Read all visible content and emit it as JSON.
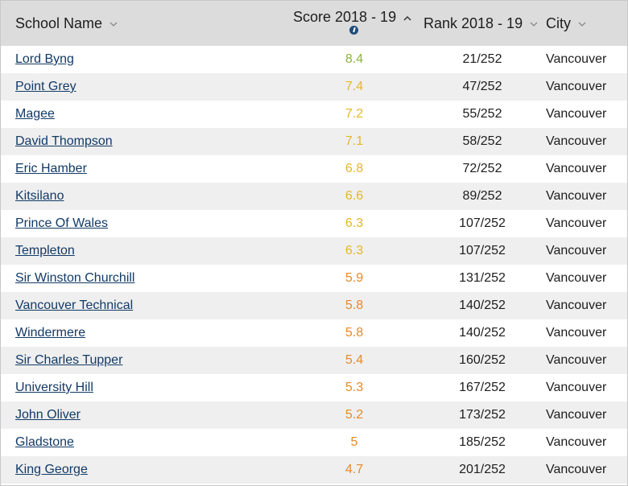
{
  "header": {
    "name_label": "School Name",
    "score_label": "Score 2018 - 19",
    "rank_label": "Rank 2018 - 19",
    "city_label": "City"
  },
  "colors": {
    "header_bg": "#dcdcdc",
    "link": "#123a66",
    "score_green": "#8cb33c",
    "score_yellow": "#e5b62a",
    "score_orange": "#e6892a"
  },
  "rows": [
    {
      "name": "Lord Byng",
      "score": "8.4",
      "rank": "21/252",
      "city": "Vancouver",
      "color": "#8cb33c"
    },
    {
      "name": "Point Grey",
      "score": "7.4",
      "rank": "47/252",
      "city": "Vancouver",
      "color": "#e5b62a"
    },
    {
      "name": "Magee",
      "score": "7.2",
      "rank": "55/252",
      "city": "Vancouver",
      "color": "#e5b62a"
    },
    {
      "name": "David Thompson",
      "score": "7.1",
      "rank": "58/252",
      "city": "Vancouver",
      "color": "#e5b62a"
    },
    {
      "name": "Eric Hamber",
      "score": "6.8",
      "rank": "72/252",
      "city": "Vancouver",
      "color": "#e5b62a"
    },
    {
      "name": "Kitsilano",
      "score": "6.6",
      "rank": "89/252",
      "city": "Vancouver",
      "color": "#e5b62a"
    },
    {
      "name": "Prince Of Wales",
      "score": "6.3",
      "rank": "107/252",
      "city": "Vancouver",
      "color": "#e5b62a"
    },
    {
      "name": "Templeton",
      "score": "6.3",
      "rank": "107/252",
      "city": "Vancouver",
      "color": "#e5b62a"
    },
    {
      "name": "Sir Winston Churchill",
      "score": "5.9",
      "rank": "131/252",
      "city": "Vancouver",
      "color": "#e6892a"
    },
    {
      "name": "Vancouver Technical",
      "score": "5.8",
      "rank": "140/252",
      "city": "Vancouver",
      "color": "#e6892a"
    },
    {
      "name": "Windermere",
      "score": "5.8",
      "rank": "140/252",
      "city": "Vancouver",
      "color": "#e6892a"
    },
    {
      "name": "Sir Charles Tupper",
      "score": "5.4",
      "rank": "160/252",
      "city": "Vancouver",
      "color": "#e6892a"
    },
    {
      "name": "University Hill",
      "score": "5.3",
      "rank": "167/252",
      "city": "Vancouver",
      "color": "#e6892a"
    },
    {
      "name": "John Oliver",
      "score": "5.2",
      "rank": "173/252",
      "city": "Vancouver",
      "color": "#e6892a"
    },
    {
      "name": "Gladstone",
      "score": "5",
      "rank": "185/252",
      "city": "Vancouver",
      "color": "#e6892a"
    },
    {
      "name": "King George",
      "score": "4.7",
      "rank": "201/252",
      "city": "Vancouver",
      "color": "#e6892a"
    }
  ]
}
